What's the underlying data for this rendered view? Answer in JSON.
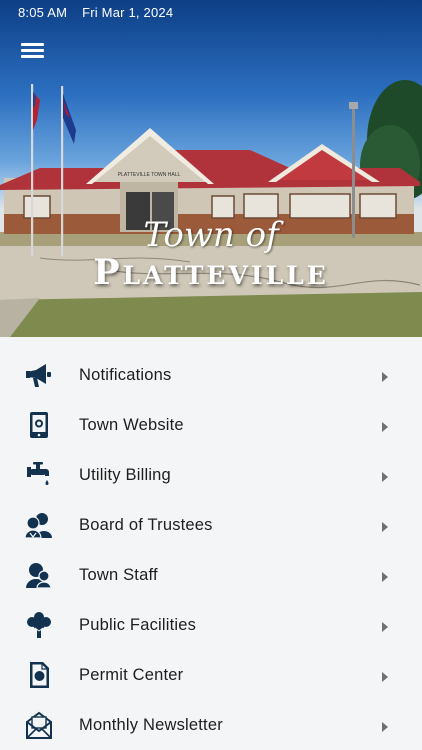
{
  "status_bar": {
    "time": "8:05 AM",
    "date": "Fri Mar 1, 2024"
  },
  "hero": {
    "town_of": "Town of",
    "town_name": "Platteville",
    "sign_text": "PLATTEVILLE TOWN HALL"
  },
  "colors": {
    "icon": "#12324f",
    "text": "#1e1e1e",
    "chevron": "#707070",
    "roof": "#b0323a"
  },
  "menu": [
    {
      "label": "Notifications",
      "icon": "megaphone-icon"
    },
    {
      "label": "Town Website",
      "icon": "tablet-icon"
    },
    {
      "label": "Utility Billing",
      "icon": "faucet-icon"
    },
    {
      "label": "Board of Trustees",
      "icon": "group-icon"
    },
    {
      "label": "Town Staff",
      "icon": "staff-icon"
    },
    {
      "label": "Public Facilities",
      "icon": "tree-icon"
    },
    {
      "label": "Permit Center",
      "icon": "document-icon"
    },
    {
      "label": "Monthly Newsletter",
      "icon": "envelope-icon"
    }
  ]
}
